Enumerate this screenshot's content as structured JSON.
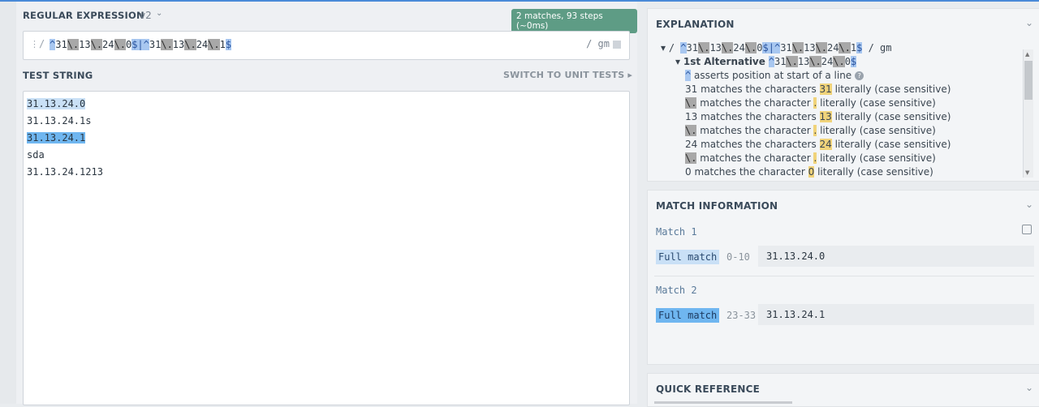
{
  "regex": {
    "title": "REGULAR EXPRESSION",
    "version": "v2",
    "badge": "2 matches, 93 steps (~0ms)",
    "open_delim": "/",
    "flags": "/ gm",
    "tokens": [
      {
        "t": "^",
        "k": "anchor"
      },
      {
        "t": "31",
        "k": "lit"
      },
      {
        "t": "\\.",
        "k": "esc"
      },
      {
        "t": "13",
        "k": "lit"
      },
      {
        "t": "\\.",
        "k": "esc"
      },
      {
        "t": "24",
        "k": "lit"
      },
      {
        "t": "\\.",
        "k": "esc"
      },
      {
        "t": "0",
        "k": "lit"
      },
      {
        "t": "$",
        "k": "anchor"
      },
      {
        "t": "|",
        "k": "alt"
      },
      {
        "t": "^",
        "k": "anchor"
      },
      {
        "t": "31",
        "k": "lit"
      },
      {
        "t": "\\.",
        "k": "esc"
      },
      {
        "t": "13",
        "k": "lit"
      },
      {
        "t": "\\.",
        "k": "esc"
      },
      {
        "t": "24",
        "k": "lit"
      },
      {
        "t": "\\.",
        "k": "esc"
      },
      {
        "t": "1",
        "k": "lit"
      },
      {
        "t": "$",
        "k": "anchor"
      }
    ]
  },
  "test": {
    "title": "TEST STRING",
    "switch_label": "SWITCH TO UNIT TESTS",
    "lines": [
      "31.13.24.0",
      "31.13.24.1s",
      "31.13.24.1",
      "sda",
      "31.13.24.1213"
    ]
  },
  "explanation": {
    "title": "EXPLANATION",
    "root": "/ ^31\\.13\\.24\\.0$|^31\\.13\\.24\\.1$ / gm",
    "alt_label": "1st Alternative",
    "alt_regex": "^31\\.13\\.24\\.0$",
    "rows": [
      {
        "tok": "^",
        "text": " asserts position at start of a line"
      },
      {
        "tok": "31",
        "text": " matches the characters ",
        "hl": "31",
        "tail": " literally (case sensitive)"
      },
      {
        "tok": "\\.",
        "text": " matches the character ",
        "hl": ".",
        "tail": " literally (case sensitive)"
      },
      {
        "tok": "13",
        "text": " matches the characters ",
        "hl": "13",
        "tail": " literally (case sensitive)"
      },
      {
        "tok": "\\.",
        "text": " matches the character ",
        "hl": ".",
        "tail": " literally (case sensitive)"
      },
      {
        "tok": "24",
        "text": " matches the characters ",
        "hl": "24",
        "tail": " literally (case sensitive)"
      },
      {
        "tok": "\\.",
        "text": " matches the character ",
        "hl": ".",
        "tail": " literally (case sensitive)"
      },
      {
        "tok": "0",
        "text": " matches the character ",
        "hl": "0",
        "tail": " literally (case sensitive)"
      }
    ]
  },
  "match_info": {
    "title": "MATCH INFORMATION",
    "matches": [
      {
        "label": "Match 1",
        "kind": "Full match",
        "range": "0-10",
        "value": "31.13.24.0"
      },
      {
        "label": "Match 2",
        "kind": "Full match",
        "range": "23-33",
        "value": "31.13.24.1"
      }
    ]
  },
  "quick_reference": {
    "title": "QUICK REFERENCE"
  }
}
